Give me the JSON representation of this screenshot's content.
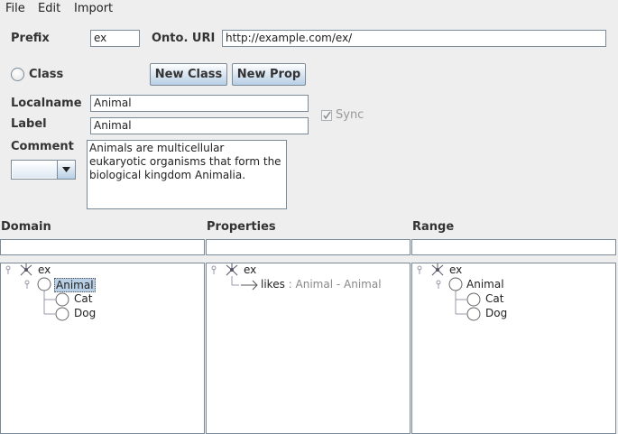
{
  "menu": {
    "file": "File",
    "edit": "Edit",
    "import": "Import"
  },
  "prefix": {
    "label": "Prefix",
    "value": "ex"
  },
  "onto_uri": {
    "label": "Onto. URI",
    "value": "http://example.com/ex/"
  },
  "class_radio": {
    "label": "Class"
  },
  "buttons": {
    "new_class": "New Class",
    "new_prop": "New Prop"
  },
  "localname": {
    "label": "Localname",
    "value": "Animal"
  },
  "label_field": {
    "label": "Label",
    "value": "Animal"
  },
  "sync": {
    "label": "Sync",
    "checked": true
  },
  "comment": {
    "label": "Comment",
    "value": "Animals are multicellular eukaryotic organisms that form the biological kingdom Animalia."
  },
  "sections": {
    "domain": "Domain",
    "properties": "Properties",
    "range": "Range"
  },
  "domain_tree": {
    "root": "ex",
    "parent": "Animal",
    "children": [
      "Cat",
      "Dog"
    ]
  },
  "properties_tree": {
    "root": "ex",
    "property": "likes",
    "property_detail": ": Animal - Animal"
  },
  "range_tree": {
    "root": "ex",
    "parent": "Animal",
    "children": [
      "Cat",
      "Dog"
    ]
  }
}
